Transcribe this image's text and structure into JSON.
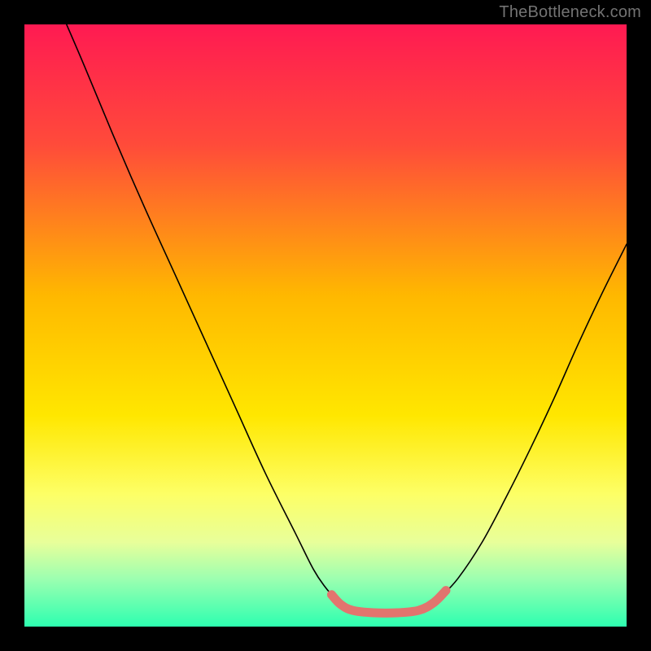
{
  "attribution": "TheBottleneck.com",
  "chart_data": {
    "type": "line",
    "title": "",
    "xlabel": "",
    "ylabel": "",
    "xlim": [
      0,
      100
    ],
    "ylim": [
      0,
      100
    ],
    "gradient_stops": [
      {
        "offset": 0,
        "color": "#ff1a52"
      },
      {
        "offset": 20,
        "color": "#ff4b3a"
      },
      {
        "offset": 45,
        "color": "#ffb800"
      },
      {
        "offset": 65,
        "color": "#ffe700"
      },
      {
        "offset": 78,
        "color": "#fdff66"
      },
      {
        "offset": 86,
        "color": "#e8ff9a"
      },
      {
        "offset": 92,
        "color": "#9dffb0"
      },
      {
        "offset": 100,
        "color": "#2dffb0"
      }
    ],
    "series": [
      {
        "name": "left-arm",
        "stroke": "#000000",
        "stroke_width": 1.6,
        "points": [
          {
            "x": 7.0,
            "y": 100.0
          },
          {
            "x": 10.0,
            "y": 93.0
          },
          {
            "x": 15.0,
            "y": 81.0
          },
          {
            "x": 20.0,
            "y": 69.5
          },
          {
            "x": 25.0,
            "y": 58.5
          },
          {
            "x": 30.0,
            "y": 47.5
          },
          {
            "x": 35.0,
            "y": 36.5
          },
          {
            "x": 40.0,
            "y": 25.5
          },
          {
            "x": 45.0,
            "y": 15.5
          },
          {
            "x": 48.0,
            "y": 9.5
          },
          {
            "x": 50.0,
            "y": 6.5
          },
          {
            "x": 51.5,
            "y": 4.8
          }
        ]
      },
      {
        "name": "right-arm",
        "stroke": "#000000",
        "stroke_width": 1.6,
        "points": [
          {
            "x": 69.0,
            "y": 4.8
          },
          {
            "x": 72.0,
            "y": 8.0
          },
          {
            "x": 76.0,
            "y": 14.0
          },
          {
            "x": 80.0,
            "y": 21.5
          },
          {
            "x": 84.0,
            "y": 29.5
          },
          {
            "x": 88.0,
            "y": 38.0
          },
          {
            "x": 92.0,
            "y": 47.0
          },
          {
            "x": 96.0,
            "y": 55.5
          },
          {
            "x": 100.0,
            "y": 63.5
          }
        ]
      }
    ],
    "floor_band": {
      "name": "valley-floor",
      "stroke": "#e2746e",
      "stroke_width": 11,
      "points": [
        {
          "x": 51.0,
          "y": 5.3
        },
        {
          "x": 52.5,
          "y": 3.7
        },
        {
          "x": 54.5,
          "y": 2.7
        },
        {
          "x": 58.0,
          "y": 2.3
        },
        {
          "x": 62.0,
          "y": 2.3
        },
        {
          "x": 65.5,
          "y": 2.7
        },
        {
          "x": 68.0,
          "y": 4.0
        },
        {
          "x": 70.0,
          "y": 6.0
        }
      ]
    }
  }
}
